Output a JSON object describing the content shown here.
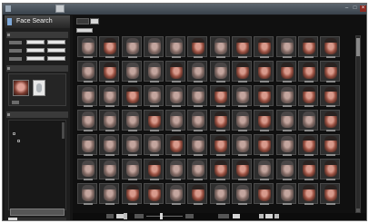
{
  "window": {
    "title": "",
    "controls": {
      "minimize": "–",
      "maximize": "□",
      "close": "×"
    }
  },
  "app": {
    "brand": "Face Search"
  },
  "left_panel": {
    "search_button": "",
    "database_tree": [
      "",
      ""
    ]
  },
  "results": {
    "tabs": [
      "",
      ""
    ],
    "rows": 7,
    "columns": 12,
    "faded_cells": [
      0,
      2,
      3,
      4,
      6,
      9,
      12,
      14,
      15,
      17,
      18,
      24,
      25,
      27,
      28,
      29,
      31,
      33,
      36,
      37,
      38,
      40,
      41,
      43,
      45,
      46,
      48,
      49,
      50,
      51,
      53,
      55,
      57,
      60,
      61,
      62,
      64,
      65,
      68,
      69,
      72,
      73,
      76,
      78,
      79,
      81
    ]
  },
  "colors": {
    "background": "#151515",
    "panel": "#1e1e1e",
    "title_bar": "#4a535c",
    "thumbnail_border": "#4a4a4a"
  }
}
